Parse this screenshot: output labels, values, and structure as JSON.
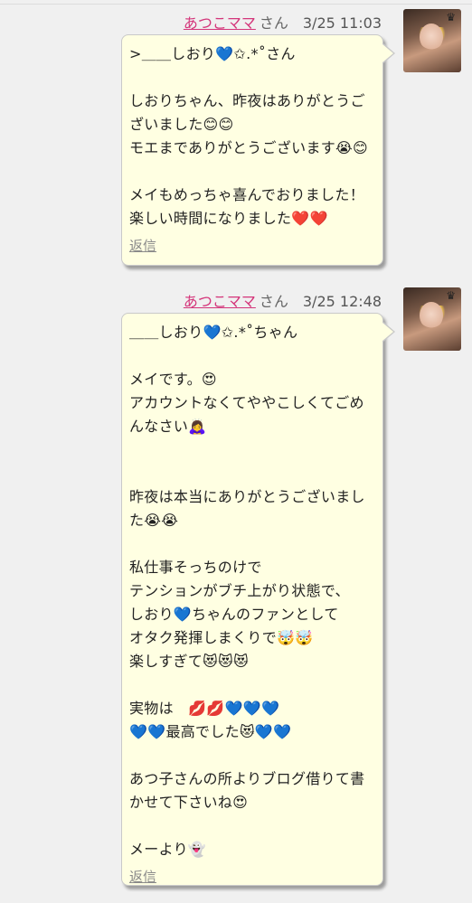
{
  "comments": [
    {
      "author": "あつこママ",
      "suffix": "さん",
      "time": "3/25 11:03",
      "body": ">＿＿しおり💙✩.*˚さん\n\nしおりちゃん、昨夜はありがとうご\nざいました😊😊\nモエまでありがとうございます😭😊\n\nメイもめっちゃ喜んでおりました！\n楽しい時間になりました❤️❤️",
      "reply_label": "返信"
    },
    {
      "author": "あつこママ",
      "suffix": "さん",
      "time": "3/25 12:48",
      "body": "＿＿しおり💙✩.*˚ちゃん\n\nメイです。😍\nアカウントなくてややこしくてごめ\nんなさい🙇‍♀️\n\n\n昨夜は本当にありがとうございまし\nた😭😭\n\n私仕事そっちのけで\nテンションがブチ上がり状態で、\nしおり💙ちゃんのファンとして\nオタク発揮しまくりで🤯🤯\n楽しすぎて😻😻😻\n\n実物は　💋💋💙💙💙\n💙💙最高でした😻💙💙\n\nあつ子さんの所よりブログ借りて書\nかせて下さいね😍\n\nメーより👻",
      "reply_label": "返信"
    }
  ]
}
